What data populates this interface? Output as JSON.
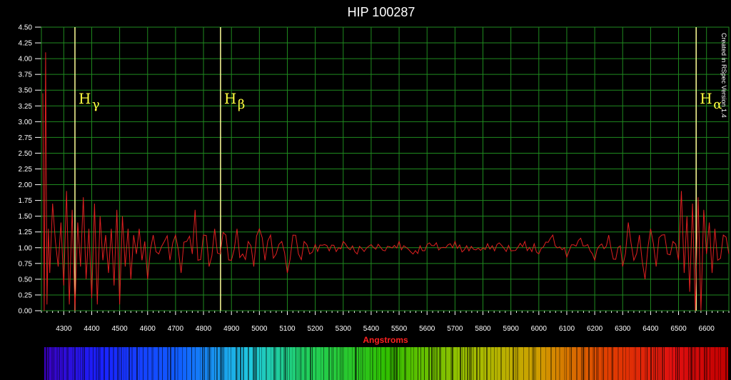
{
  "colors": {
    "background": "#000000",
    "grid": "#1f8a1f",
    "series": "#e02020",
    "reference_line": "#ffff99",
    "xlabel": "#ff2020"
  },
  "chart_data": {
    "type": "line",
    "title": "HIP 100287",
    "xlabel": "Angstroms",
    "ylabel": "",
    "xlim": [
      4220,
      6680
    ],
    "ylim": [
      0,
      4.5
    ],
    "grid": true,
    "x_ticks": [
      4300,
      4400,
      4500,
      4600,
      4700,
      4800,
      4900,
      5000,
      5100,
      5200,
      5300,
      5400,
      5500,
      5600,
      5700,
      5800,
      5900,
      6000,
      6100,
      6200,
      6300,
      6400,
      6500,
      6600
    ],
    "y_ticks": [
      "0.00",
      "0.25",
      "0.50",
      "0.75",
      "1.00",
      "1.25",
      "1.50",
      "1.75",
      "2.00",
      "2.25",
      "2.50",
      "2.75",
      "3.00",
      "3.25",
      "3.50",
      "3.75",
      "4.00",
      "4.25",
      "4.50"
    ],
    "reference_lines": [
      {
        "label": "H",
        "sub": "γ",
        "x": 4340
      },
      {
        "label": "H",
        "sub": "β",
        "x": 4861
      },
      {
        "label": "H",
        "sub": "α",
        "x": 6563
      }
    ],
    "credit": "Created in RSpec Version 1.4",
    "series": [
      {
        "x": [
          4225,
          4230,
          4235,
          4240,
          4245,
          4250,
          4260,
          4270,
          4280,
          4290,
          4300,
          4310,
          4320,
          4330,
          4340,
          4350,
          4360,
          4370,
          4380,
          4390,
          4400,
          4410,
          4420,
          4430,
          4440,
          4450,
          4460,
          4470,
          4480,
          4490,
          4500,
          4510,
          4520,
          4530,
          4540,
          4550,
          4560,
          4570,
          4580,
          4590,
          4600,
          4620,
          4640,
          4660,
          4680,
          4700,
          4720,
          4740,
          4760,
          4770,
          4780,
          4800,
          4820,
          4840,
          4860,
          4880,
          4900,
          4920,
          4940,
          4960,
          4980,
          5000,
          5020,
          5040,
          5060,
          5080,
          5100,
          5120,
          5140,
          5160,
          5180,
          5200,
          5250,
          5300,
          5350,
          5400,
          5450,
          5500,
          5550,
          5600,
          5650,
          5700,
          5750,
          5800,
          5850,
          5900,
          5950,
          6000,
          6050,
          6100,
          6150,
          6200,
          6250,
          6300,
          6320,
          6340,
          6360,
          6380,
          6400,
          6420,
          6440,
          6460,
          6480,
          6500,
          6510,
          6520,
          6530,
          6540,
          6550,
          6560,
          6570,
          6580,
          6590,
          6600,
          6610,
          6620,
          6630,
          6640,
          6660,
          6680
        ],
        "y": [
          3.45,
          0.0,
          4.1,
          0.1,
          1.3,
          0.6,
          1.7,
          1.1,
          0.7,
          1.4,
          0.4,
          1.9,
          0.1,
          1.6,
          0.0,
          1.4,
          0.7,
          1.8,
          0.5,
          1.3,
          0.2,
          1.7,
          0.1,
          1.5,
          0.8,
          1.2,
          0.6,
          1.3,
          0.4,
          1.6,
          0.1,
          1.5,
          0.7,
          1.3,
          0.5,
          1.2,
          0.9,
          1.3,
          0.8,
          1.1,
          0.5,
          1.2,
          0.9,
          1.1,
          0.8,
          1.2,
          0.6,
          1.1,
          0.9,
          1.6,
          0.8,
          1.2,
          0.7,
          1.3,
          0.9,
          1.2,
          0.8,
          1.3,
          0.9,
          1.1,
          0.7,
          1.3,
          0.8,
          1.2,
          0.9,
          1.1,
          0.6,
          1.2,
          0.9,
          1.1,
          0.9,
          1.05,
          0.95,
          1.1,
          0.9,
          1.05,
          0.95,
          1.1,
          0.9,
          1.05,
          1.0,
          1.1,
          0.95,
          1.0,
          1.05,
          0.95,
          1.1,
          0.9,
          1.2,
          0.85,
          1.15,
          0.8,
          1.2,
          0.7,
          1.4,
          0.8,
          1.2,
          0.5,
          1.3,
          0.7,
          1.2,
          0.9,
          1.1,
          0.8,
          1.9,
          0.6,
          1.5,
          0.3,
          1.7,
          0.0,
          1.8,
          0.0,
          1.6,
          0.9,
          1.4,
          0.6,
          1.3,
          0.8,
          1.2,
          0.9
        ]
      }
    ]
  }
}
